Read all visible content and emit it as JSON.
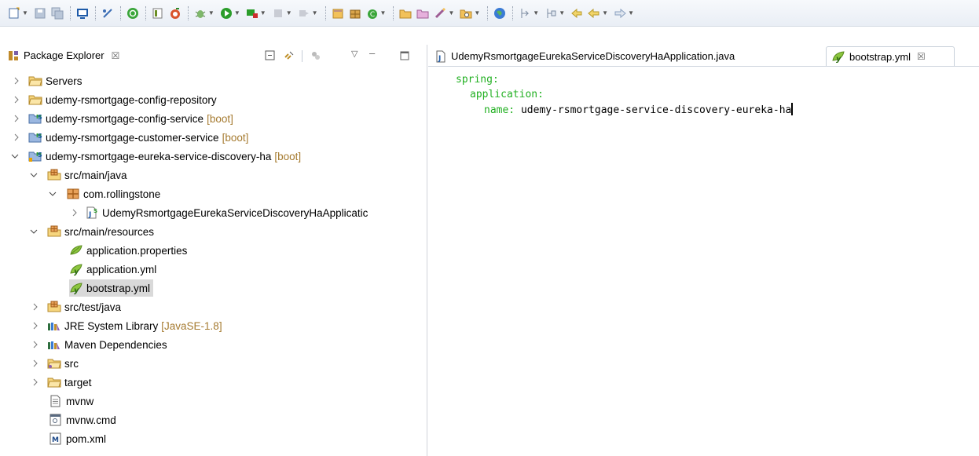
{
  "explorer": {
    "title": "Package Explorer",
    "close_glyph": "☒"
  },
  "tabs": [
    {
      "label": "UdemyRsmortgageEurekaServiceDiscoveryHaApplication.java",
      "icon": "java-file-icon"
    },
    {
      "label": "bootstrap.yml",
      "icon": "yaml-file-icon",
      "close_glyph": "☒"
    }
  ],
  "tree": [
    {
      "label": "Servers",
      "icon": "folder-icon"
    },
    {
      "label": "udemy-rsmortgage-config-repository",
      "icon": "folder-icon"
    },
    {
      "label": "udemy-rsmortgage-config-service",
      "deco": "[boot]",
      "icon": "spring-project-icon"
    },
    {
      "label": "udemy-rsmortgage-customer-service",
      "deco": "[boot]",
      "icon": "spring-project-icon"
    },
    {
      "label": "udemy-rsmortgage-eureka-service-discovery-ha",
      "deco": "[boot]",
      "icon": "spring-project-icon"
    },
    {
      "label": "src/main/java",
      "icon": "source-folder-icon"
    },
    {
      "label": "com.rollingstone",
      "icon": "package-icon"
    },
    {
      "label": "UdemyRsmortgageEurekaServiceDiscoveryHaApplicatic",
      "icon": "java-class-icon"
    },
    {
      "label": "src/main/resources",
      "icon": "source-folder-icon"
    },
    {
      "label": "application.properties",
      "icon": "properties-icon"
    },
    {
      "label": "application.yml",
      "icon": "yaml-file-icon"
    },
    {
      "label": "bootstrap.yml",
      "icon": "yaml-file-icon"
    },
    {
      "label": "src/test/java",
      "icon": "source-folder-icon"
    },
    {
      "label": "JRE System Library",
      "deco": "[JavaSE-1.8]",
      "icon": "library-icon"
    },
    {
      "label": "Maven Dependencies",
      "icon": "library-icon"
    },
    {
      "label": "src",
      "icon": "folder-icon"
    },
    {
      "label": "target",
      "icon": "folder-icon"
    },
    {
      "label": "mvnw",
      "icon": "text-file-icon"
    },
    {
      "label": "mvnw.cmd",
      "icon": "cmd-file-icon"
    },
    {
      "label": "pom.xml",
      "icon": "maven-pom-icon"
    }
  ],
  "editor": {
    "lines": [
      {
        "key": "spring:",
        "value": ""
      },
      {
        "key": "application:",
        "value": ""
      },
      {
        "key": "name:",
        "value": "udemy-rsmortgage-service-discovery-eureka-ha"
      }
    ]
  },
  "colors": {
    "yaml_key": "#22b022",
    "decoration": "#a57a2f",
    "selection": "#d9d9d9"
  }
}
